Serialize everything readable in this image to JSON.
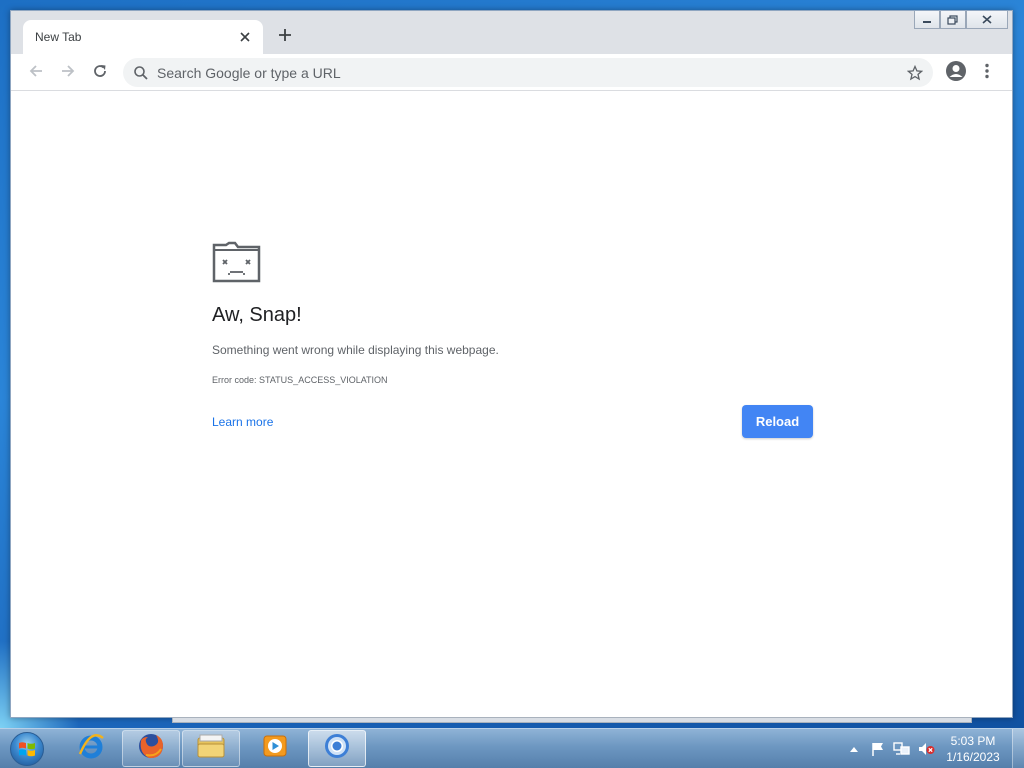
{
  "browser": {
    "tab": {
      "title": "New Tab",
      "close_icon": "close-icon"
    },
    "new_tab_icon": "plus-icon",
    "omnibox": {
      "placeholder": "Search Google or type a URL",
      "value": ""
    }
  },
  "error_page": {
    "title": "Aw, Snap!",
    "description": "Something went wrong while displaying this webpage.",
    "error_code": "Error code: STATUS_ACCESS_VIOLATION",
    "learn_more": "Learn more",
    "reload_label": "Reload",
    "accent_color": "#4285f4"
  },
  "taskbar": {
    "apps": [
      "Internet Explorer",
      "Firefox",
      "Windows Explorer",
      "Windows Media Player",
      "Google Chrome"
    ],
    "clock": {
      "time": "5:03 PM",
      "date": "1/16/2023"
    }
  }
}
